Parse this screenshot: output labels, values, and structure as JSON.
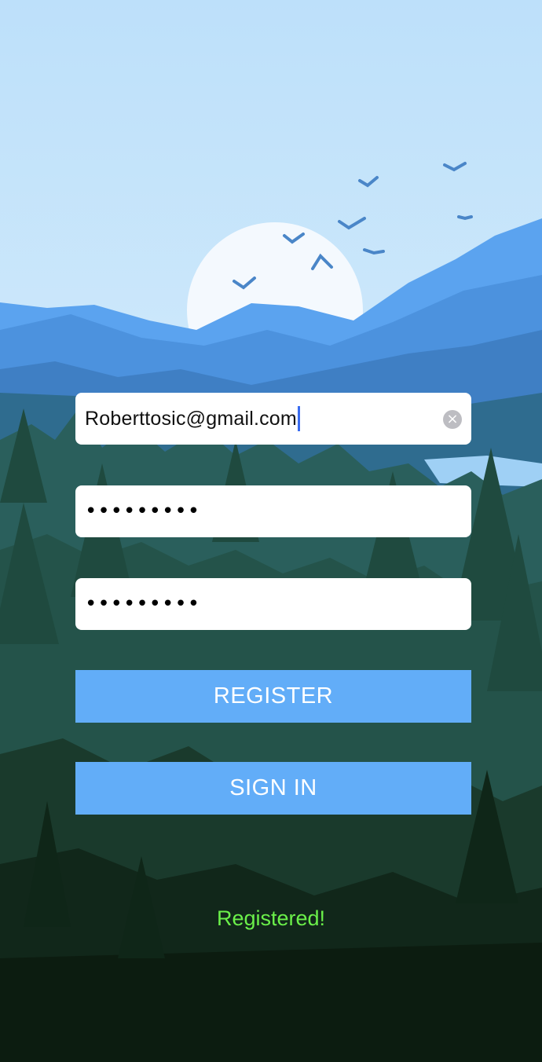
{
  "form": {
    "email": {
      "value": "Roberttosic@gmail.com"
    },
    "password": {
      "masked": "•••••••••"
    },
    "confirm_password": {
      "masked": "•••••••••"
    }
  },
  "buttons": {
    "register_label": "REGISTER",
    "signin_label": "SIGN IN"
  },
  "status": {
    "text": "Registered!",
    "color": "#6bf04a"
  },
  "colors": {
    "button": "#62adf8",
    "field": "#ffffff"
  },
  "icons": {
    "clear": "clear-circle-x-icon"
  }
}
